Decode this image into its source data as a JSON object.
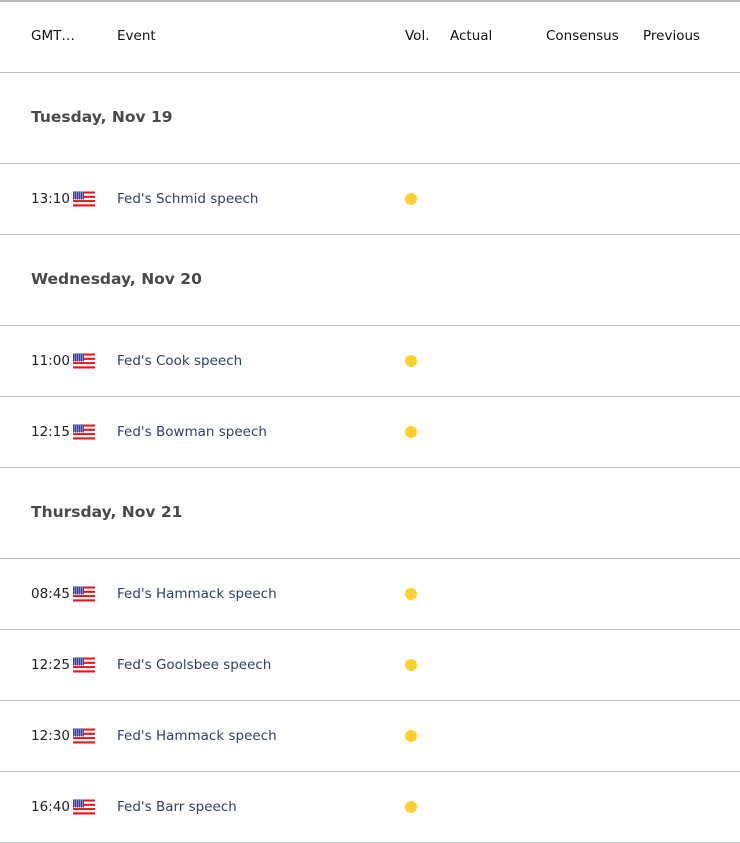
{
  "header": {
    "gmt": "GMT…",
    "event": "Event",
    "vol": "Vol.",
    "actual": "Actual",
    "consensus": "Consensus",
    "previous": "Previous"
  },
  "colors": {
    "volatility_dot": "#ffd130",
    "event_text": "#2d3f6e",
    "day_text": "#4a4a4a",
    "divider": "#bfc2c2"
  },
  "days": [
    {
      "label": "Tuesday, Nov 19",
      "events": [
        {
          "time": "13:10",
          "country_icon": "us-flag-icon",
          "event": "Fed's Schmid speech",
          "volatility": "low",
          "actual": "",
          "consensus": "",
          "previous": ""
        }
      ]
    },
    {
      "label": "Wednesday, Nov 20",
      "events": [
        {
          "time": "11:00",
          "country_icon": "us-flag-icon",
          "event": "Fed's Cook speech",
          "volatility": "low",
          "actual": "",
          "consensus": "",
          "previous": ""
        },
        {
          "time": "12:15",
          "country_icon": "us-flag-icon",
          "event": "Fed's Bowman speech",
          "volatility": "low",
          "actual": "",
          "consensus": "",
          "previous": ""
        }
      ]
    },
    {
      "label": "Thursday, Nov 21",
      "events": [
        {
          "time": "08:45",
          "country_icon": "us-flag-icon",
          "event": "Fed's Hammack speech",
          "volatility": "low",
          "actual": "",
          "consensus": "",
          "previous": ""
        },
        {
          "time": "12:25",
          "country_icon": "us-flag-icon",
          "event": "Fed's Goolsbee speech",
          "volatility": "low",
          "actual": "",
          "consensus": "",
          "previous": ""
        },
        {
          "time": "12:30",
          "country_icon": "us-flag-icon",
          "event": "Fed's Hammack speech",
          "volatility": "low",
          "actual": "",
          "consensus": "",
          "previous": ""
        },
        {
          "time": "16:40",
          "country_icon": "us-flag-icon",
          "event": "Fed's Barr speech",
          "volatility": "low",
          "actual": "",
          "consensus": "",
          "previous": ""
        }
      ]
    }
  ]
}
